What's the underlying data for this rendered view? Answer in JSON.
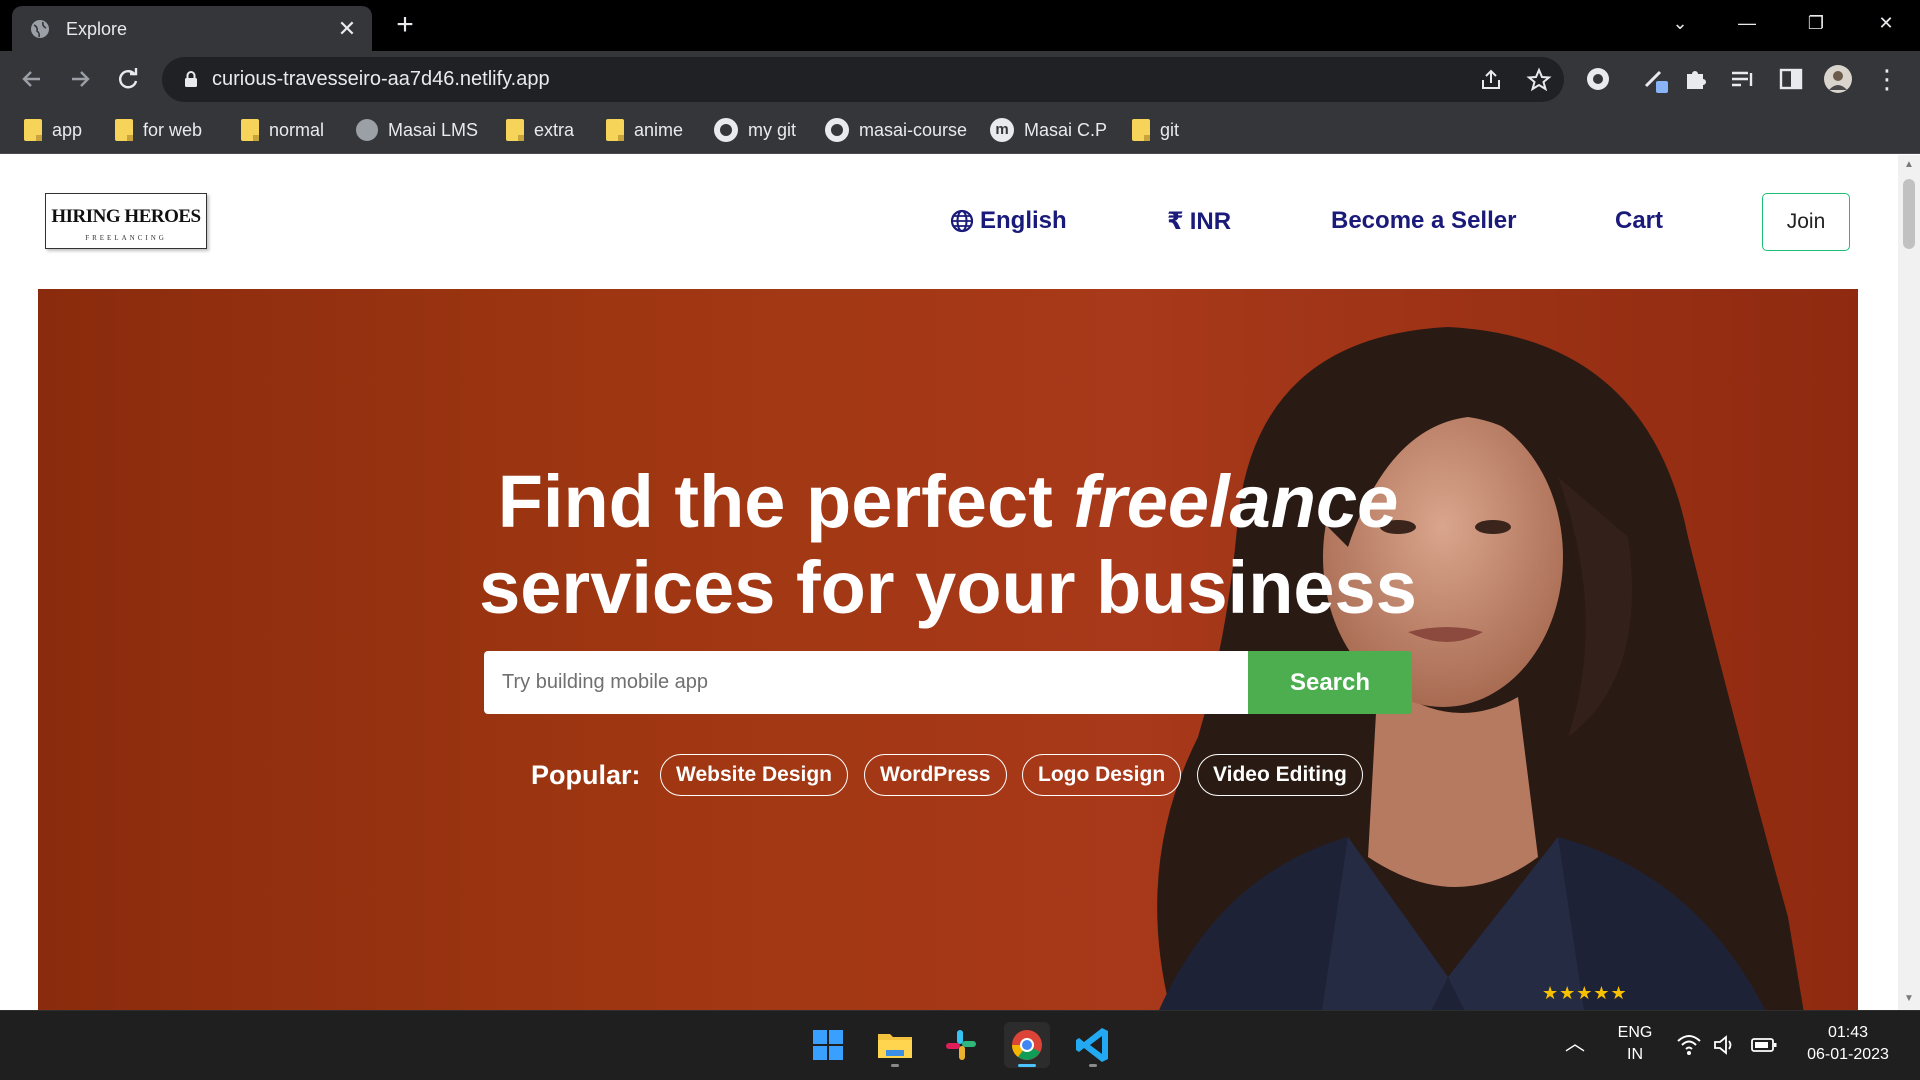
{
  "browser": {
    "tab_title": "Explore",
    "url": "curious-travesseiro-aa7d46.netlify.app",
    "bookmarks": [
      {
        "label": "app",
        "icon": "folder-icon"
      },
      {
        "label": "for web",
        "icon": "folder-icon"
      },
      {
        "label": "normal",
        "icon": "folder-icon"
      },
      {
        "label": "Masai LMS",
        "icon": "globe-icon"
      },
      {
        "label": "extra",
        "icon": "folder-icon"
      },
      {
        "label": "anime",
        "icon": "folder-icon"
      },
      {
        "label": "my git",
        "icon": "github-icon"
      },
      {
        "label": "masai-course",
        "icon": "github-icon"
      },
      {
        "label": "Masai C.P",
        "icon": "masai-icon"
      },
      {
        "label": "git",
        "icon": "folder-icon"
      }
    ]
  },
  "site": {
    "logo_text": "HIRING HEROES",
    "logo_sub": "FREELANCING",
    "nav": {
      "language": "English",
      "currency": "INR",
      "currency_symbol": "₹",
      "seller": "Become a Seller",
      "cart": "Cart",
      "join": "Join"
    },
    "hero": {
      "title_part1": "Find the perfect",
      "title_italic": "freelance",
      "title_line2": "services for your business",
      "search_placeholder": "Try building mobile app",
      "search_button": "Search",
      "popular_label": "Popular:",
      "popular_tags": [
        "Website Design",
        "WordPress",
        "Logo Design",
        "Video Editing"
      ],
      "rating_stars": "★★★★★"
    },
    "colors": {
      "hero_bg": "#a03712",
      "search_button": "#4cae4f",
      "nav_text": "#1a1a7a",
      "join_border": "#1dbf73"
    }
  },
  "taskbar": {
    "language_line1": "ENG",
    "language_line2": "IN",
    "time": "01:43",
    "date": "06-01-2023",
    "apps": [
      "windows-start-icon",
      "file-explorer-icon",
      "slack-icon",
      "chrome-icon",
      "vscode-icon"
    ]
  }
}
